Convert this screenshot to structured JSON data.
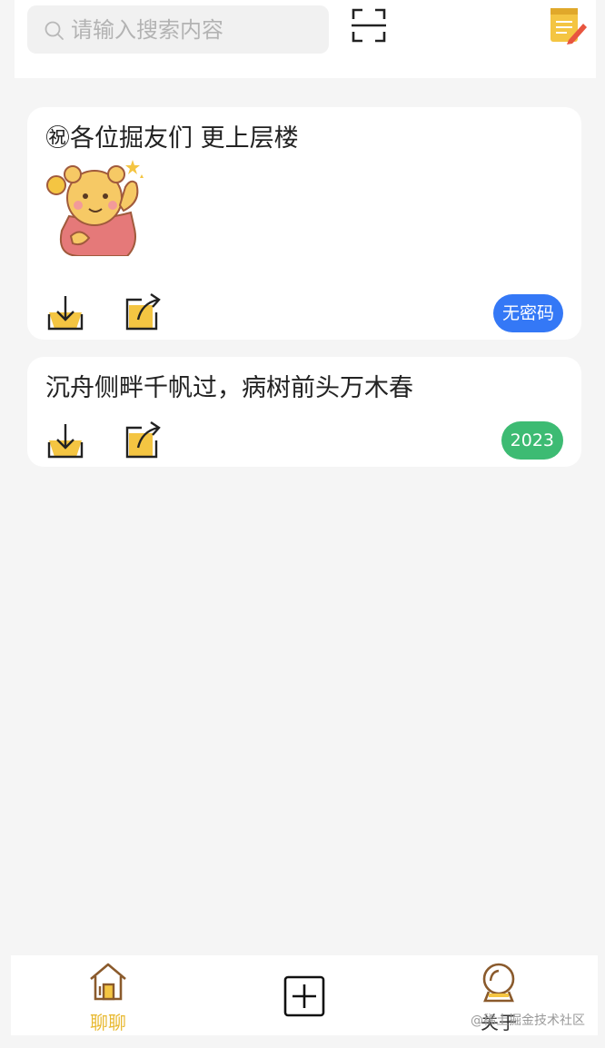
{
  "search": {
    "placeholder": "请输入搜索内容",
    "icon": "search-icon"
  },
  "header": {
    "scan_icon": "scan-icon",
    "notepad_icon": "notepad-icon"
  },
  "notes": [
    {
      "text": "㊗各位掘友们 更上层楼",
      "tag": "无密码",
      "tag_color": "#3478f6",
      "has_sticker": true
    },
    {
      "text": "沉舟侧畔千帆过，病树前头万木春",
      "tag": "2023",
      "tag_color": "#3dbb73",
      "has_sticker": false
    }
  ],
  "tabbar": {
    "chat_label": "聊聊",
    "about_label": "关于",
    "active_color": "#e8b931"
  },
  "watermark": "@稀土掘金技术社区"
}
